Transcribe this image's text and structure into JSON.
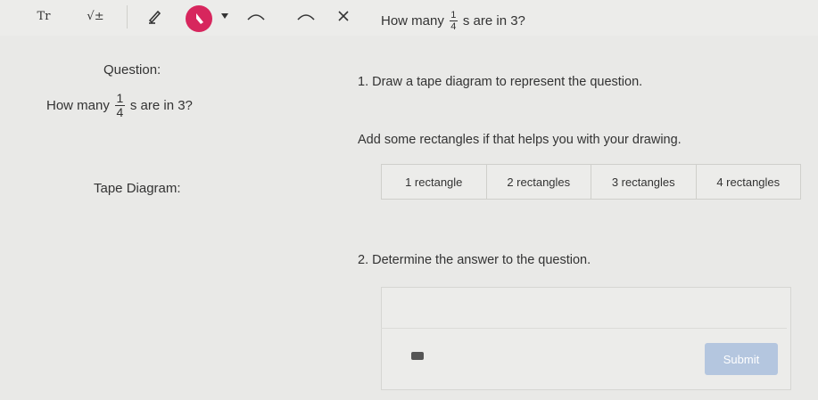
{
  "toolbar": {
    "text_tool_label": "Tr",
    "sqrt_tool_label": "√±",
    "tools": [
      {
        "icon": "text-icon"
      },
      {
        "icon": "sqrt-icon"
      },
      {
        "icon": "pencil-icon"
      },
      {
        "icon": "pen-color-icon",
        "color": "#d7265d"
      },
      {
        "icon": "undo-icon"
      },
      {
        "icon": "redo-icon"
      },
      {
        "icon": "close-icon"
      }
    ],
    "question_prefix": "How many",
    "question_frac_num": "1",
    "question_frac_den": "4",
    "question_suffix": "s are in 3?"
  },
  "left": {
    "question_label": "Question:",
    "how_many_prefix": "How many",
    "frac_num": "1",
    "frac_den": "4",
    "how_many_suffix": "s are in 3?",
    "tape_label": "Tape Diagram:"
  },
  "right": {
    "step1": "1. Draw a tape diagram to represent the question.",
    "hint": "Add some rectangles if that helps you with your drawing.",
    "rectangles": [
      "1 rectangle",
      "2 rectangles",
      "3 rectangles",
      "4 rectangles"
    ],
    "step2": "2. Determine the answer to the question.",
    "submit_label": "Submit"
  }
}
